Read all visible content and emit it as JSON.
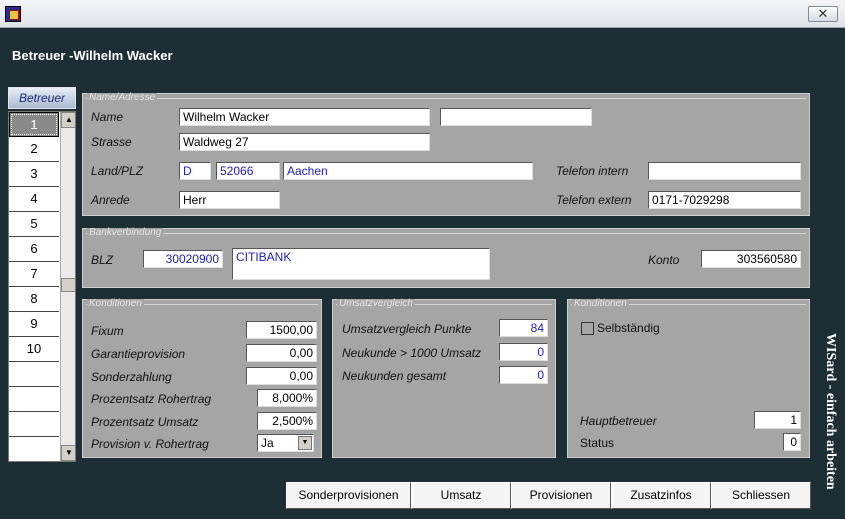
{
  "window": {
    "close_glyph": "✕"
  },
  "header": {
    "title": "Betreuer -Wilhelm Wacker"
  },
  "list": {
    "header": "Betreuer",
    "rows": [
      "1",
      "2",
      "3",
      "4",
      "5",
      "6",
      "7",
      "8",
      "9",
      "10",
      "",
      "",
      ""
    ],
    "selected": "1",
    "scroll_up": "▲",
    "scroll_down": "▼"
  },
  "name_panel": {
    "legend": "Name/Adresse",
    "name_label": "Name",
    "name_value": "Wilhelm Wacker",
    "name2_value": "",
    "street_label": "Strasse",
    "street_value": "Waldweg 27",
    "country_label": "Land/PLZ",
    "country_value": "D",
    "zip_value": "52066",
    "city_value": "Aachen",
    "salutation_label": "Anrede",
    "salutation_value": "Herr",
    "phone_internal_label": "Telefon intern",
    "phone_internal_value": "",
    "phone_external_label": "Telefon extern",
    "phone_external_value": "0171-7029298"
  },
  "bank_panel": {
    "legend": "Bankverbindung",
    "blz_label": "BLZ",
    "blz_value": "30020900",
    "bank_name": "CITIBANK",
    "account_label": "Konto",
    "account_value": "303560580"
  },
  "conditions_panel": {
    "legend": "Konditionen",
    "fixum_label": "Fixum",
    "fixum_value": "1500,00",
    "guarantee_label": "Garantieprovision",
    "guarantee_value": "0,00",
    "special_label": "Sonderzahlung",
    "special_value": "0,00",
    "gross_pct_label": "Prozentsatz Rohertrag",
    "gross_pct_value": "8,000%",
    "sales_pct_label": "Prozentsatz Umsatz",
    "sales_pct_value": "2,500%",
    "commission_label": "Provision v. Rohertrag",
    "commission_value": "Ja"
  },
  "sales_panel": {
    "legend": "Umsatzvergleich",
    "points_label": "Umsatzvergleich Punkte",
    "points_value": "84",
    "new_customers_label": "Neukunde > 1000 Umsatz",
    "new_customers_value": "0",
    "new_total_label": "Neukunden gesamt",
    "new_total_value": "0"
  },
  "conditions2_panel": {
    "legend": "Konditionen",
    "self_employed_label": "Selbständig",
    "self_employed_checked": false,
    "main_supervisor_label": "Hauptbetreuer",
    "main_supervisor_value": "1",
    "status_label": "Status",
    "status_value": "0"
  },
  "side_text": "WISard - einfach arbeiten",
  "buttons": {
    "special_commissions": "Sonderprovisionen",
    "sales": "Umsatz",
    "commissions": "Provisionen",
    "additional_info": "Zusatzinfos",
    "close": "Schliessen"
  }
}
